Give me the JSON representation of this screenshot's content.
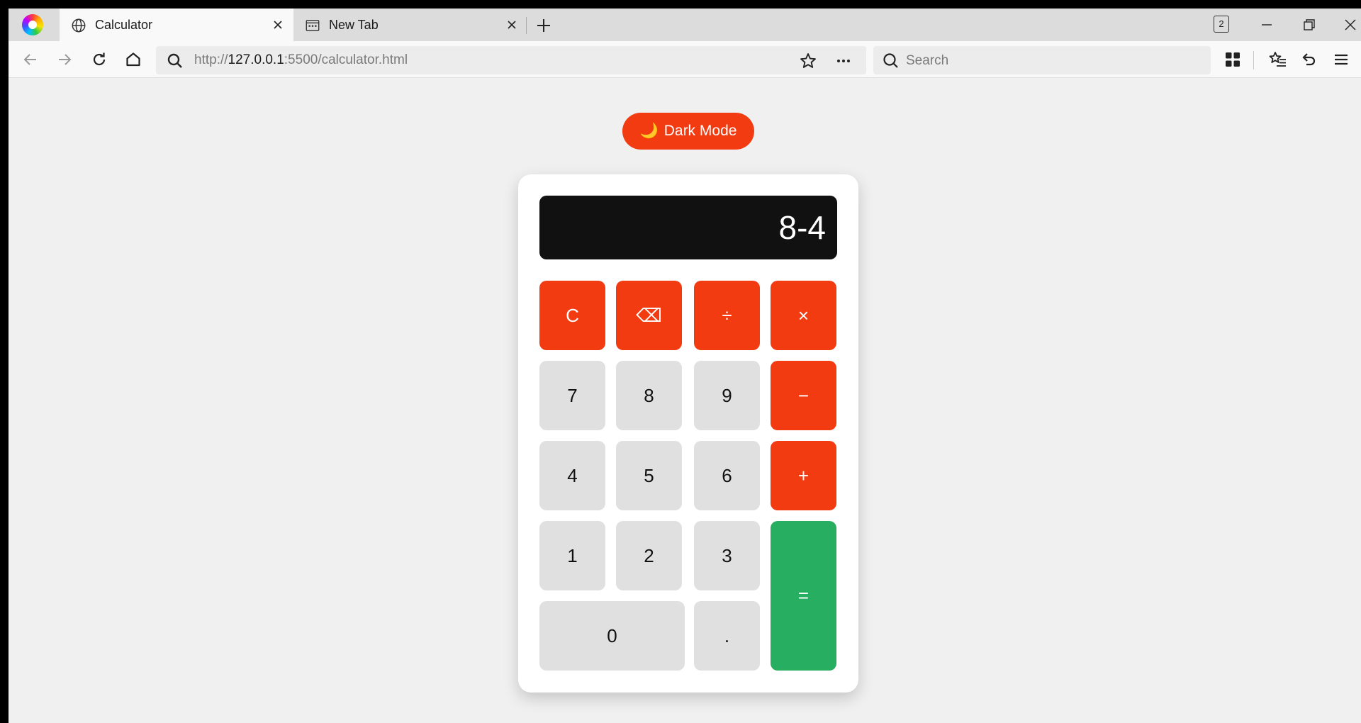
{
  "browser": {
    "tabs": [
      {
        "title": "Calculator",
        "active": true,
        "icon": "globe-icon"
      },
      {
        "title": "New Tab",
        "active": false,
        "icon": "new-tab-page-icon"
      }
    ],
    "tab_count": "2",
    "url": {
      "scheme": "http://",
      "host": "127.0.0.1",
      "rest": ":5500/calculator.html"
    },
    "search_placeholder": "Search"
  },
  "page": {
    "dark_mode": {
      "icon": "🌙",
      "label": "Dark Mode"
    },
    "display": "8-4",
    "keys": {
      "clear": "C",
      "backspace": "⌫",
      "divide": "÷",
      "multiply": "×",
      "seven": "7",
      "eight": "8",
      "nine": "9",
      "minus": "−",
      "four": "4",
      "five": "5",
      "six": "6",
      "plus": "+",
      "one": "1",
      "two": "2",
      "three": "3",
      "equals": "=",
      "zero": "0",
      "decimal": "."
    },
    "colors": {
      "operator": "#f33b12",
      "equals": "#27ae60",
      "number": "#e0e0e0",
      "display_bg": "#111111"
    }
  }
}
